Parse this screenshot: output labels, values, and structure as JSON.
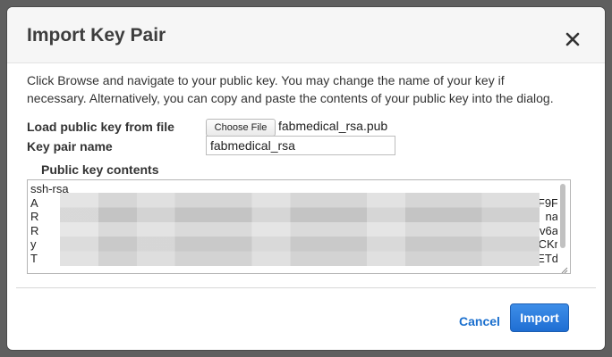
{
  "dialog": {
    "title": "Import Key Pair",
    "close_icon": "close-icon",
    "intro_line1": "Click Browse and navigate to your public key. You may change the name of your key if",
    "intro_line2": "necessary. Alternatively, you can copy and paste the contents of your public key into the dialog."
  },
  "form": {
    "load_label": "Load public key from file",
    "choose_file_label": "Choose File",
    "file_name": "fabmedical_rsa.pub",
    "key_pair_label": "Key pair name",
    "key_pair_value": "fabmedical_rsa",
    "contents_label": "Public key contents",
    "key_lines": [
      {
        "lead": "ssh-rsa",
        "tail": ""
      },
      {
        "lead": "A",
        "tail": "F9F"
      },
      {
        "lead": "R",
        "tail": "na"
      },
      {
        "lead": "R",
        "tail": "v6a"
      },
      {
        "lead": "y",
        "tail": "CKr"
      },
      {
        "lead": "T",
        "tail": "ETd"
      }
    ]
  },
  "footer": {
    "cancel_label": "Cancel",
    "import_label": "Import"
  },
  "colors": {
    "accent": "#1f6ed3",
    "link": "#1a6fce"
  }
}
